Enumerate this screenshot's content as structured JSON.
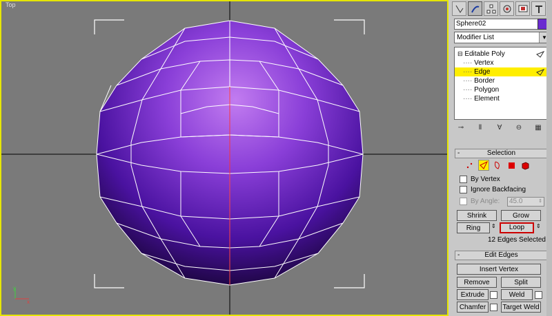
{
  "viewport": {
    "label": "Top",
    "colors": {
      "background": "#7a7a7a",
      "active_border": "#e6e600",
      "edge": "#ffffff",
      "sphere_light": "#b06ee8",
      "sphere_dark": "#1a0540"
    }
  },
  "command_panel": {
    "tabs": [
      "create-icon",
      "modify-icon",
      "hierarchy-icon",
      "motion-icon",
      "display-icon",
      "utilities-icon"
    ],
    "object_name": "Sphere02",
    "object_color": "#6a2bd0",
    "modifier_list": "Modifier List",
    "stack": {
      "root": "Editable Poly",
      "subobjects": [
        "Vertex",
        "Edge",
        "Border",
        "Polygon",
        "Element"
      ],
      "selected": "Edge"
    }
  },
  "selection": {
    "title": "Selection",
    "by_vertex": "By Vertex",
    "ignore_backfacing": "Ignore Backfacing",
    "by_angle": "By Angle:",
    "by_angle_value": "45.0",
    "shrink": "Shrink",
    "grow": "Grow",
    "ring": "Ring",
    "loop": "Loop",
    "status": "12 Edges Selected"
  },
  "edit_edges": {
    "title": "Edit Edges",
    "insert_vertex": "Insert Vertex",
    "remove": "Remove",
    "split": "Split",
    "extrude": "Extrude",
    "weld": "Weld",
    "chamfer": "Chamfer",
    "target_weld": "Target Weld"
  }
}
